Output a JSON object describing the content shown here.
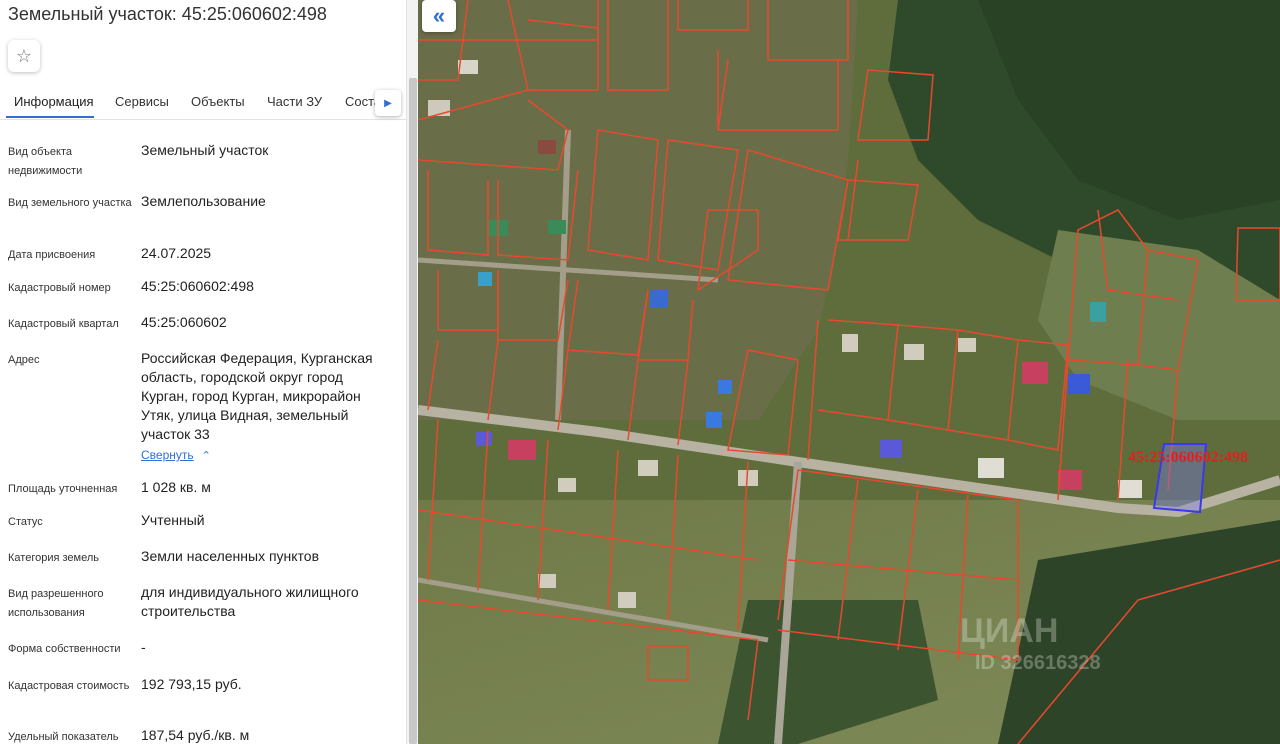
{
  "header": {
    "title": "Земельный участок: 45:25:060602:498",
    "favorite_icon": "star-outline-icon"
  },
  "tabs": [
    {
      "label": "Информация"
    },
    {
      "label": "Сервисы"
    },
    {
      "label": "Объекты"
    },
    {
      "label": "Части ЗУ"
    },
    {
      "label": "Состав"
    }
  ],
  "fields": [
    {
      "label": "Вид объекта недвижимости",
      "value": "Земельный участок"
    },
    {
      "label": "Вид земельного участка",
      "value": "Землепользование"
    },
    {
      "label": "Дата присвоения",
      "value": "24.07.2025"
    },
    {
      "label": "Кадастровый номер",
      "value": "45:25:060602:498"
    },
    {
      "label": "Кадастровый квартал",
      "value": "45:25:060602"
    },
    {
      "label": "Адрес",
      "value": "Российская Федерация, Курганская область, городской округ город Курган, город Курган, микрорайон Утяк, улица Видная, земельный участок 33"
    },
    {
      "label": "Площадь уточненная",
      "value": "1 028 кв. м"
    },
    {
      "label": "Статус",
      "value": "Учтенный"
    },
    {
      "label": "Категория земель",
      "value": "Земли населенных пунктов"
    },
    {
      "label": "Вид разрешенного использования",
      "value": "для индивидуального жилищного строительства"
    },
    {
      "label": "Форма собственности",
      "value": "-"
    },
    {
      "label": "Кадастровая стоимость",
      "value": "192 793,15 руб."
    },
    {
      "label": "Удельный показатель",
      "value": "187,54 руб./кв. м"
    }
  ],
  "address_toggle": "Свернуть",
  "map": {
    "parcel_label": "45:25:060602:498",
    "watermark": "ЦИАН",
    "watermark_id": "ID 326616328",
    "collapse_icon": "double-chevron-left-icon",
    "boundary_color": "#e8492e",
    "selected_color": "#3a3ae8"
  }
}
